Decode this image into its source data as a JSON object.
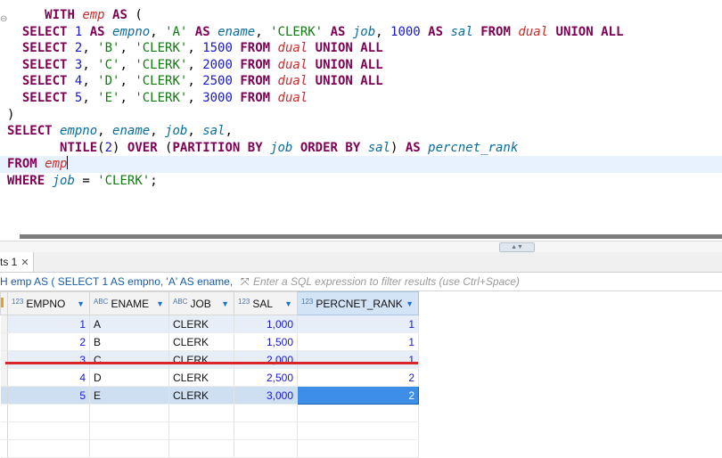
{
  "editor": {
    "lines": [
      [
        {
          "t": "     "
        },
        {
          "t": "WITH",
          "c": "kw"
        },
        {
          "t": " "
        },
        {
          "t": "emp",
          "c": "tbl"
        },
        {
          "t": " "
        },
        {
          "t": "AS",
          "c": "kw"
        },
        {
          "t": " ("
        }
      ],
      [
        {
          "t": "  "
        },
        {
          "t": "SELECT",
          "c": "kw"
        },
        {
          "t": " "
        },
        {
          "t": "1",
          "c": "num"
        },
        {
          "t": " "
        },
        {
          "t": "AS",
          "c": "kw"
        },
        {
          "t": " "
        },
        {
          "t": "empno",
          "c": "col"
        },
        {
          "t": ", "
        },
        {
          "t": "'A'",
          "c": "str"
        },
        {
          "t": " "
        },
        {
          "t": "AS",
          "c": "kw"
        },
        {
          "t": " "
        },
        {
          "t": "ename",
          "c": "col"
        },
        {
          "t": ", "
        },
        {
          "t": "'CLERK'",
          "c": "str"
        },
        {
          "t": " "
        },
        {
          "t": "AS",
          "c": "kw"
        },
        {
          "t": " "
        },
        {
          "t": "job",
          "c": "col"
        },
        {
          "t": ", "
        },
        {
          "t": "1000",
          "c": "num"
        },
        {
          "t": " "
        },
        {
          "t": "AS",
          "c": "kw"
        },
        {
          "t": " "
        },
        {
          "t": "sal",
          "c": "col"
        },
        {
          "t": " "
        },
        {
          "t": "FROM",
          "c": "kw"
        },
        {
          "t": " "
        },
        {
          "t": "dual",
          "c": "tbl"
        },
        {
          "t": " "
        },
        {
          "t": "UNION ALL",
          "c": "kw"
        }
      ],
      [
        {
          "t": "  "
        },
        {
          "t": "SELECT",
          "c": "kw"
        },
        {
          "t": " "
        },
        {
          "t": "2",
          "c": "num"
        },
        {
          "t": ", "
        },
        {
          "t": "'B'",
          "c": "str"
        },
        {
          "t": ", "
        },
        {
          "t": "'CLERK'",
          "c": "str"
        },
        {
          "t": ", "
        },
        {
          "t": "1500",
          "c": "num"
        },
        {
          "t": " "
        },
        {
          "t": "FROM",
          "c": "kw"
        },
        {
          "t": " "
        },
        {
          "t": "dual",
          "c": "tbl"
        },
        {
          "t": " "
        },
        {
          "t": "UNION ALL",
          "c": "kw"
        }
      ],
      [
        {
          "t": "  "
        },
        {
          "t": "SELECT",
          "c": "kw"
        },
        {
          "t": " "
        },
        {
          "t": "3",
          "c": "num"
        },
        {
          "t": ", "
        },
        {
          "t": "'C'",
          "c": "str"
        },
        {
          "t": ", "
        },
        {
          "t": "'CLERK'",
          "c": "str"
        },
        {
          "t": ", "
        },
        {
          "t": "2000",
          "c": "num"
        },
        {
          "t": " "
        },
        {
          "t": "FROM",
          "c": "kw"
        },
        {
          "t": " "
        },
        {
          "t": "dual",
          "c": "tbl"
        },
        {
          "t": " "
        },
        {
          "t": "UNION ALL",
          "c": "kw"
        }
      ],
      [
        {
          "t": "  "
        },
        {
          "t": "SELECT",
          "c": "kw"
        },
        {
          "t": " "
        },
        {
          "t": "4",
          "c": "num"
        },
        {
          "t": ", "
        },
        {
          "t": "'D'",
          "c": "str"
        },
        {
          "t": ", "
        },
        {
          "t": "'CLERK'",
          "c": "str"
        },
        {
          "t": ", "
        },
        {
          "t": "2500",
          "c": "num"
        },
        {
          "t": " "
        },
        {
          "t": "FROM",
          "c": "kw"
        },
        {
          "t": " "
        },
        {
          "t": "dual",
          "c": "tbl"
        },
        {
          "t": " "
        },
        {
          "t": "UNION ALL",
          "c": "kw"
        }
      ],
      [
        {
          "t": "  "
        },
        {
          "t": "SELECT",
          "c": "kw"
        },
        {
          "t": " "
        },
        {
          "t": "5",
          "c": "num"
        },
        {
          "t": ", "
        },
        {
          "t": "'E'",
          "c": "str"
        },
        {
          "t": ", "
        },
        {
          "t": "'CLERK'",
          "c": "str"
        },
        {
          "t": ", "
        },
        {
          "t": "3000",
          "c": "num"
        },
        {
          "t": " "
        },
        {
          "t": "FROM",
          "c": "kw"
        },
        {
          "t": " "
        },
        {
          "t": "dual",
          "c": "tbl"
        }
      ],
      [
        {
          "t": ")"
        }
      ],
      [
        {
          "t": "SELECT",
          "c": "kw"
        },
        {
          "t": " "
        },
        {
          "t": "empno",
          "c": "col"
        },
        {
          "t": ", "
        },
        {
          "t": "ename",
          "c": "col"
        },
        {
          "t": ", "
        },
        {
          "t": "job",
          "c": "col"
        },
        {
          "t": ", "
        },
        {
          "t": "sal",
          "c": "col"
        },
        {
          "t": ","
        }
      ],
      [
        {
          "t": "       "
        },
        {
          "t": "NTILE",
          "c": "kw"
        },
        {
          "t": "("
        },
        {
          "t": "2",
          "c": "num"
        },
        {
          "t": ") "
        },
        {
          "t": "OVER",
          "c": "kw"
        },
        {
          "t": " ("
        },
        {
          "t": "PARTITION BY",
          "c": "kw"
        },
        {
          "t": " "
        },
        {
          "t": "job",
          "c": "col"
        },
        {
          "t": " "
        },
        {
          "t": "ORDER BY",
          "c": "kw"
        },
        {
          "t": " "
        },
        {
          "t": "sal",
          "c": "col"
        },
        {
          "t": ") "
        },
        {
          "t": "AS",
          "c": "kw"
        },
        {
          "t": " "
        },
        {
          "t": "percnet_rank",
          "c": "col"
        }
      ],
      [
        {
          "t": "FROM",
          "c": "kw"
        },
        {
          "t": " "
        },
        {
          "t": "emp",
          "c": "tbl"
        }
      ],
      [
        {
          "t": "WHERE",
          "c": "kw"
        },
        {
          "t": " "
        },
        {
          "t": "job",
          "c": "col"
        },
        {
          "t": " = "
        },
        {
          "t": "'CLERK'",
          "c": "str"
        },
        {
          "t": ";"
        }
      ]
    ],
    "current_line": 9
  },
  "results_tab": {
    "label": "ts 1"
  },
  "filter_bar": {
    "query_text": "H emp AS ( SELECT 1 AS empno, 'A' AS ename, '",
    "placeholder": "Enter a SQL expression to filter results (use Ctrl+Space)"
  },
  "grid": {
    "columns": [
      {
        "type": "123",
        "label": "EMPNO",
        "align": "num"
      },
      {
        "type": "ABC",
        "label": "ENAME",
        "align": "text"
      },
      {
        "type": "ABC",
        "label": "JOB",
        "align": "text"
      },
      {
        "type": "123",
        "label": "SAL",
        "align": "num"
      },
      {
        "type": "123",
        "label": "PERCNET_RANK",
        "align": "num"
      }
    ],
    "rows": [
      [
        "1",
        "A",
        "CLERK",
        "1,000",
        "1"
      ],
      [
        "2",
        "B",
        "CLERK",
        "1,500",
        "1"
      ],
      [
        "3",
        "C",
        "CLERK",
        "2,000",
        "1"
      ],
      [
        "4",
        "D",
        "CLERK",
        "2,500",
        "2"
      ],
      [
        "5",
        "E",
        "CLERK",
        "3,000",
        "2"
      ]
    ],
    "selected_row": 4,
    "selected_col": 4
  },
  "colors": {
    "keyword": "#7f0055",
    "column": "#0a6d9d",
    "string": "#117a11",
    "number": "#1717d4",
    "table": "#d0292b",
    "annotation": "#d9262a"
  }
}
